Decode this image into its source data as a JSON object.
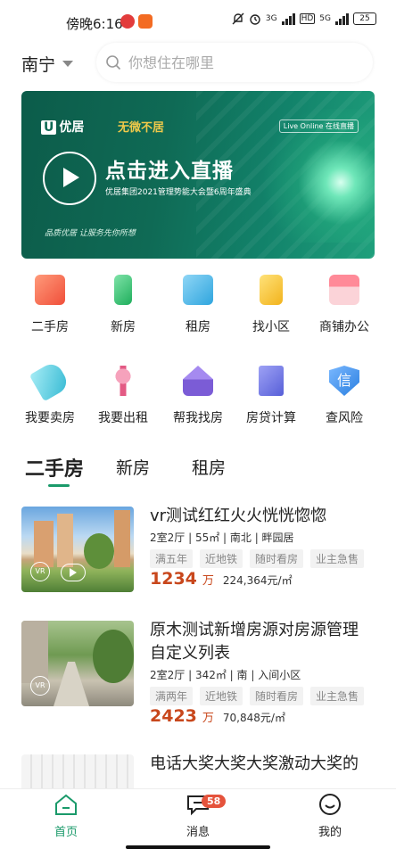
{
  "status": {
    "time": "傍晚6:16",
    "signal1": "3G",
    "hd": "HD",
    "signal2": "5G",
    "battery": "25"
  },
  "header": {
    "city": "南宁",
    "search_placeholder": "你想住在哪里"
  },
  "banner": {
    "brand": "优居",
    "brand2": "无微不居",
    "live_tag": "Live Online 在线直播",
    "title": "点击进入直播",
    "subtitle": "优居集团2021管理势能大会暨6周年盛典",
    "slogan": "品质优居 让服务先你所想"
  },
  "grid": {
    "items": [
      {
        "label": "二手房",
        "icon": "secondhand-house-icon",
        "color": "#f26a4b"
      },
      {
        "label": "新房",
        "icon": "new-house-icon",
        "color": "#33c07a"
      },
      {
        "label": "租房",
        "icon": "rent-house-icon",
        "color": "#4ab8e8"
      },
      {
        "label": "找小区",
        "icon": "community-icon",
        "color": "#f5c63a"
      },
      {
        "label": "商铺办公",
        "icon": "shop-office-icon",
        "color": "#f47d8c"
      },
      {
        "label": "我要卖房",
        "icon": "sell-house-icon",
        "color": "#5cc8dc"
      },
      {
        "label": "我要出租",
        "icon": "lease-out-icon",
        "color": "#e85f86"
      },
      {
        "label": "帮我找房",
        "icon": "find-house-icon",
        "color": "#8a6cde"
      },
      {
        "label": "房贷计算",
        "icon": "mortgage-calc-icon",
        "color": "#6c72e0"
      },
      {
        "label": "查风险",
        "icon": "risk-check-icon",
        "color": "#3e8ee6"
      }
    ]
  },
  "tabs": [
    "二手房",
    "新房",
    "租房"
  ],
  "listings": [
    {
      "title": "vr测试红红火火恍恍惚惚",
      "meta": "2室2厅 | 55㎡ | 南北 | 畔园居",
      "tags": [
        "满五年",
        "近地铁",
        "随时看房",
        "业主急售"
      ],
      "price": "1234",
      "price_unit": "万",
      "unit_price": "224,364元/㎡"
    },
    {
      "title": "原木测试新增房源对房源管理自定义列表",
      "meta": "2室2厅 | 342㎡ | 南 | 入间小区",
      "tags": [
        "满两年",
        "近地铁",
        "随时看房",
        "业主急售"
      ],
      "price": "2423",
      "price_unit": "万",
      "unit_price": "70,848元/㎡"
    },
    {
      "title": "电话大奖大奖大奖激动大奖的"
    }
  ],
  "vr_label": "VR",
  "nav": {
    "home": "首页",
    "messages": "消息",
    "messages_badge": "58",
    "mine": "我的"
  },
  "colors": {
    "accent": "#1a9a6a",
    "price": "#c8471c",
    "badge": "#e5533c"
  }
}
